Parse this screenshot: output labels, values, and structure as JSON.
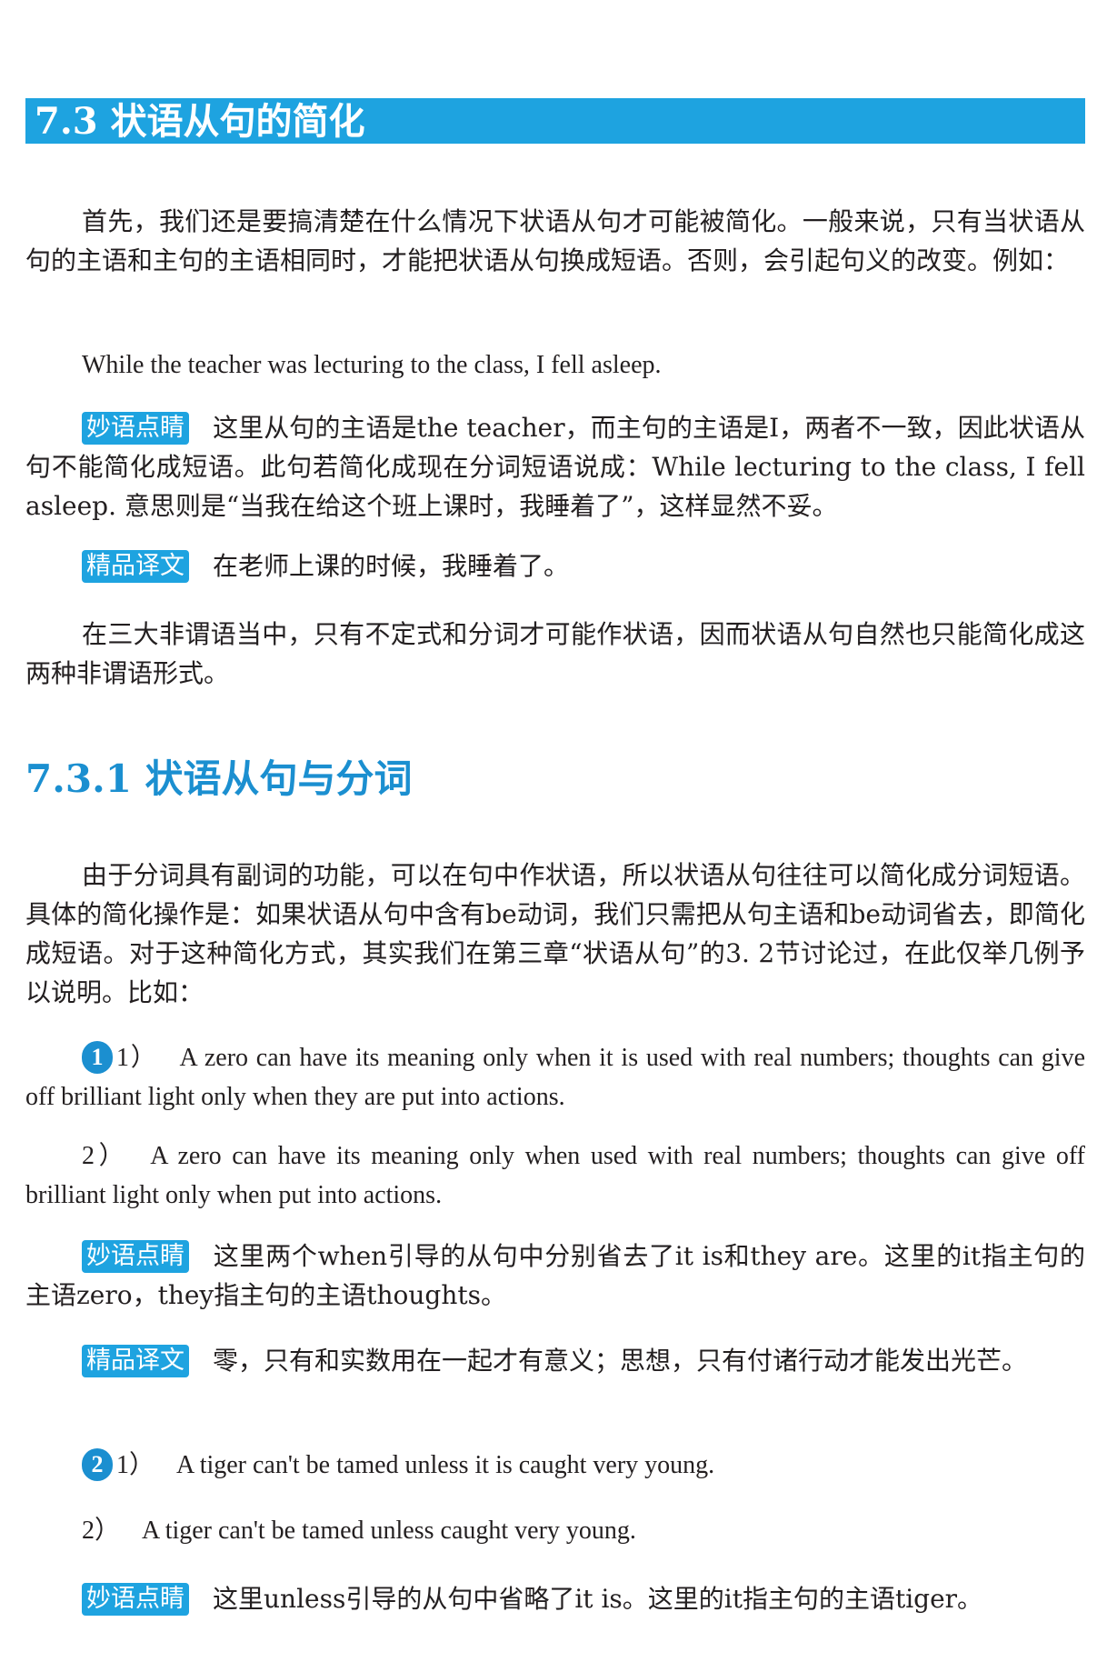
{
  "section": {
    "title": "7.3 状语从句的简化"
  },
  "intro": {
    "p1": "首先，我们还是要搞清楚在什么情况下状语从句才可能被简化。一般来说，只有当状语从句的主语和主句的主语相同时，才能把状语从句换成短语。否则，会引起句义的改变。例如：",
    "example": "While the teacher was lecturing to the class, I fell asleep.",
    "note_tag": "妙语点睛",
    "note_text": "这里从句的主语是the teacher，而主句的主语是I，两者不一致，因此状语从句不能简化成短语。此句若简化成现在分词短语说成：While lecturing to the class, I fell asleep. 意思则是“当我在给这个班上课时，我睡着了”，这样显然不妥。",
    "trans_tag": "精品译文",
    "trans_text": "在老师上课的时候，我睡着了。",
    "p2": "在三大非谓语当中，只有不定式和分词才可能作状语，因而状语从句自然也只能简化成这两种非谓语形式。"
  },
  "subsection": {
    "title": "7.3.1 状语从句与分词",
    "p1": "由于分词具有副词的功能，可以在句中作状语，所以状语从句往往可以简化成分词短语。具体的简化操作是：如果状语从句中含有be动词，我们只需把从句主语和be动词省去，即简化成短语。对于这种简化方式，其实我们在第三章“状语从句”的3. 2节讨论过，在此仅举几例予以说明。比如："
  },
  "examples": [
    {
      "badge": "1",
      "s1_label": "1）",
      "s1_text": "A zero can have its meaning only when it is used with real numbers; thoughts can give off brilliant light only when they are put into actions.",
      "s2_label": "2）",
      "s2_text": "A zero can have its meaning only when used with real numbers; thoughts can give off brilliant light only when put into actions.",
      "note_tag": "妙语点睛",
      "note_text": "这里两个when引导的从句中分别省去了it is和they are。这里的it指主句的主语zero，they指主句的主语thoughts。",
      "trans_tag": "精品译文",
      "trans_text": "零，只有和实数用在一起才有意义；思想，只有付诸行动才能发出光芒。"
    },
    {
      "badge": "2",
      "s1_label": "1）",
      "s1_text": "A tiger can't be tamed unless it is caught very young.",
      "s2_label": "2）",
      "s2_text": "A tiger can't be tamed unless caught very young.",
      "note_tag": "妙语点睛",
      "note_text": "这里unless引导的从句中省略了it is。这里的it指主句的主语tiger。"
    }
  ],
  "colors": {
    "accent": "#1ea3e0",
    "heading_blue": "#1b8fd0",
    "text": "#231f20"
  }
}
